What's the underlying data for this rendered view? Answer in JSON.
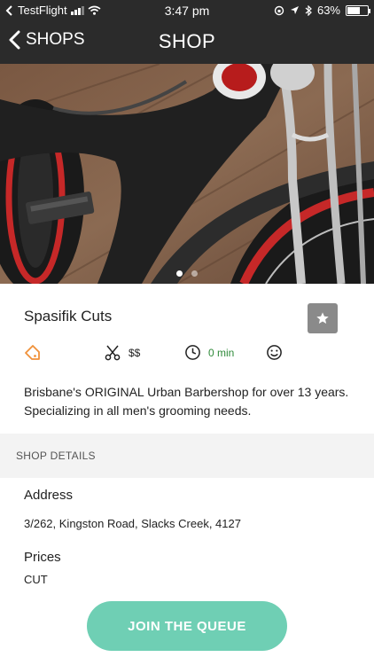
{
  "status_bar": {
    "carrier": "TestFlight",
    "time": "3:47 pm",
    "battery_percent": "63%",
    "battery_level": 0.63
  },
  "nav": {
    "back_label": "SHOPS",
    "title": "SHOP"
  },
  "gallery": {
    "page_count": 2,
    "active_page": 1
  },
  "shop": {
    "name": "Spasifik Cuts",
    "price_level": "$$",
    "wait_time": "0 min",
    "description": "Brisbane's ORIGINAL Urban Barbershop for over 13 years. Specializing in all men's grooming needs."
  },
  "details": {
    "section_title": "SHOP DETAILS",
    "address_label": "Address",
    "address_value": "3/262, Kingston Road, Slacks Creek, 4127",
    "prices_label": "Prices",
    "prices_value": "CUT"
  },
  "actions": {
    "join_label": "JOIN THE QUEUE"
  },
  "colors": {
    "nav_bg": "#2b2b2b",
    "accent": "#6fcfb4",
    "tag_orange": "#f0913a",
    "wait_green": "#2f8a3a",
    "fav_bg": "#8a8a8a"
  },
  "icons": {
    "tag": "tag-icon",
    "scissors": "scissors-icon",
    "clock": "clock-icon",
    "smile": "smile-icon",
    "star": "star-icon"
  }
}
